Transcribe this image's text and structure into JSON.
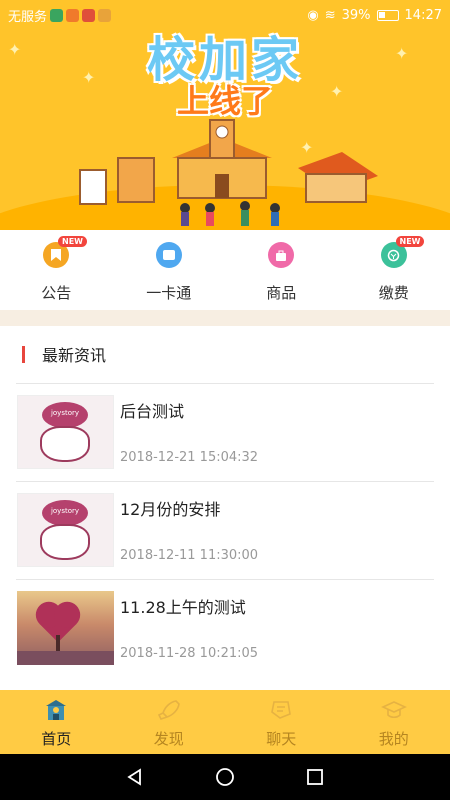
{
  "status_bar": {
    "carrier": "无服务",
    "battery": "39%",
    "time": "14:27"
  },
  "banner": {
    "title": "校加家",
    "subtitle": "上线了"
  },
  "quick_nav": [
    {
      "label": "公告",
      "icon": "bookmark-icon",
      "color": "#F5A623",
      "badge": "NEW"
    },
    {
      "label": "一卡通",
      "icon": "card-icon",
      "color": "#4FA8F0",
      "badge": ""
    },
    {
      "label": "商品",
      "icon": "shopping-bag-icon",
      "color": "#F06AA8",
      "badge": ""
    },
    {
      "label": "缴费",
      "icon": "payment-icon",
      "color": "#3CC19A",
      "badge": "NEW"
    }
  ],
  "news": {
    "section_title": "最新资讯",
    "items": [
      {
        "title": "后台测试",
        "date": "2018-12-21 15:04:32",
        "thumb_text": "joystory"
      },
      {
        "title": "12月份的安排",
        "date": "2018-12-11 11:30:00",
        "thumb_text": "joystory"
      },
      {
        "title": "11.28上午的测试",
        "date": "2018-11-28 10:21:05",
        "thumb_text": ""
      }
    ]
  },
  "tab_bar": [
    {
      "label": "首页",
      "icon": "school-icon",
      "active": true
    },
    {
      "label": "发现",
      "icon": "rocket-icon",
      "active": false
    },
    {
      "label": "聊天",
      "icon": "chat-icon",
      "active": false
    },
    {
      "label": "我的",
      "icon": "graduation-cap-icon",
      "active": false
    }
  ],
  "colors": {
    "brand_yellow": "#FFC42A",
    "tab_bar": "#FFCB44",
    "accent_red": "#E8463D"
  }
}
